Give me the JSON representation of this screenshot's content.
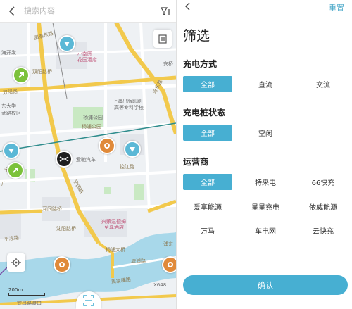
{
  "search": {
    "placeholder": "搜索内容"
  },
  "map": {
    "labels": {
      "l1": "国泰东路",
      "l2": "小南园",
      "l3": "花园酒店",
      "l4": "海开发",
      "l5": "东大学",
      "l6": "武路校区",
      "l7": "双阳路桥",
      "l8": "双阳路",
      "l9": "舟东路",
      "l10": "安桥",
      "l11": "上海出版印刷",
      "l12": "高等专科学校",
      "l13": "杨浦公园",
      "l14": "杨浦公园",
      "l15": "爱驰汽车",
      "l16": "控江路",
      "l17": "宁国路",
      "l18": "河间路桥",
      "l19": "沈阳路桥",
      "l20": "平凉路",
      "l21": "兴荣温德姆",
      "l22": "至尊酒店",
      "l23": "杨浦大桥",
      "l24": "塘浦路",
      "l25": "周家嘴路",
      "l26": "宜昌路渡口",
      "l27": "200m",
      "l28": "X648",
      "l29": "浦东",
      "l30": "宁国路",
      "l31": "广"
    },
    "scale_label": "200m"
  },
  "filter": {
    "reset_label": "重置",
    "title": "筛选",
    "sections": {
      "method": {
        "title": "充电方式",
        "options": [
          "全部",
          "直流",
          "交流"
        ]
      },
      "status": {
        "title": "充电桩状态",
        "options": [
          "全部",
          "空闲"
        ]
      },
      "operator": {
        "title": "运营商",
        "options": [
          "全部",
          "特来电",
          "66快充",
          "爱享能源",
          "星星充电",
          "依威能源",
          "万马",
          "车电网",
          "云快充"
        ]
      }
    },
    "confirm_label": "确认"
  },
  "colors": {
    "accent": "#47afd2",
    "marker_green": "#7cc23b",
    "marker_orange": "#e08a3a",
    "marker_teal": "#5bb8d6"
  }
}
